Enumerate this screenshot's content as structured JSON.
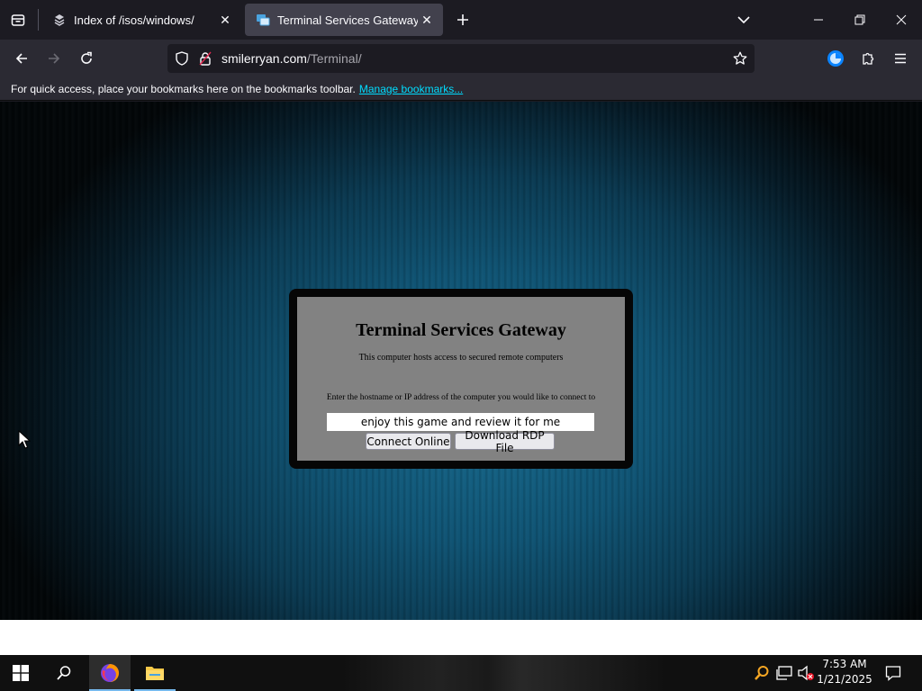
{
  "browser": {
    "tabs": [
      {
        "title": "Index of /isos/windows/",
        "active": false,
        "icon": "server-icon"
      },
      {
        "title": "Terminal Services Gateway",
        "active": true,
        "icon": "remote-desktop-icon"
      }
    ],
    "new_tab_icon": "plus-icon",
    "url": {
      "host": "smilerryan.com",
      "path": "/Terminal/"
    },
    "bookmarks_bar": {
      "message": "For quick access, place your bookmarks here on the bookmarks toolbar.",
      "manage_link": "Manage bookmarks..."
    }
  },
  "page": {
    "title": "Terminal Services Gateway",
    "subtitle": "This computer hosts access to secured remote computers",
    "prompt": "Enter the hostname or IP address of the computer you would like to connect to",
    "host_input_value": "enjoy this game and review it for me",
    "connect_button": "Connect Online",
    "download_button": "Download RDP File"
  },
  "taskbar": {
    "apps": [
      {
        "name": "Firefox",
        "active": true
      },
      {
        "name": "File Explorer",
        "active": false
      }
    ],
    "clock": {
      "time": "7:53 AM",
      "date": "1/21/2025"
    }
  },
  "colors": {
    "tab_active": "#42414d",
    "toolbar": "#2b2a33",
    "link": "#00ddff",
    "gateway_panel": "#828282",
    "taskbar_accent": "#76b9ed"
  }
}
